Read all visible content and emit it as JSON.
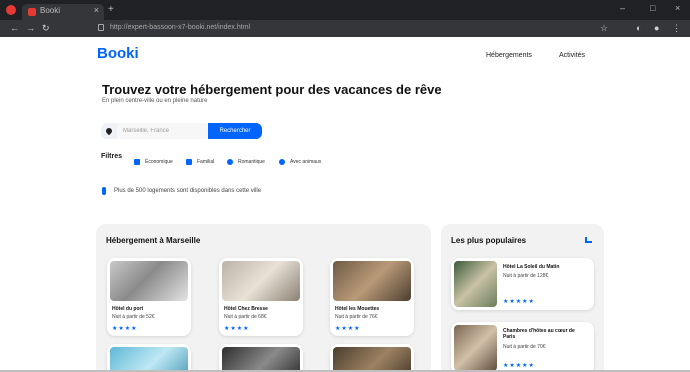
{
  "browser": {
    "tab_title": "Booki",
    "tab_close": "×",
    "new_tab": "+",
    "url": "http://expert-bassoon-x7-booki.net/index.html",
    "nav": {
      "back": "←",
      "forward": "→",
      "reload": "↻"
    },
    "window_controls": {
      "minimize": "–",
      "maximize": "□",
      "close": "×"
    }
  },
  "header": {
    "logo": "Booki",
    "nav": [
      "Hébergements",
      "Activités"
    ]
  },
  "hero": {
    "title": "Trouvez votre hébergement pour des vacances de rêve",
    "subtitle": "En plein centre-ville ou en pleine nature"
  },
  "search": {
    "placeholder": "Marseille, France",
    "button": "Rechercher"
  },
  "filters": {
    "label": "Filtres",
    "items": [
      "Économique",
      "Familial",
      "Romantique",
      "Avec animaux"
    ]
  },
  "info": {
    "text": "Plus de 500 logements sont disponibles dans cette ville"
  },
  "hebergements": {
    "title": "Hébergement à Marseille",
    "cards": [
      {
        "name": "Hôtel du port",
        "price": "Nuit à partir de 52€",
        "stars": "★★★★"
      },
      {
        "name": "Hôtel Chez Bresse",
        "price": "Nuit à partir de 68€",
        "stars": "★★★★"
      },
      {
        "name": "Hôtel les Mouettes",
        "price": "Nuit à partir de 76€",
        "stars": "★★★★"
      }
    ]
  },
  "populaires": {
    "title": "Les plus populaires",
    "cards": [
      {
        "name": "Hôtel La Soleil du Matin",
        "price": "Nuit à partir de 128€",
        "stars": "★★★★★"
      },
      {
        "name": "Chambres d'hôtes au cœur de Paris",
        "price": "Nuit à partir de 70€",
        "stars": "★★★★★"
      }
    ]
  },
  "colors": {
    "accent": "#0065fc",
    "section_bg": "#f2f2f2",
    "chrome_dark": "#202124"
  }
}
